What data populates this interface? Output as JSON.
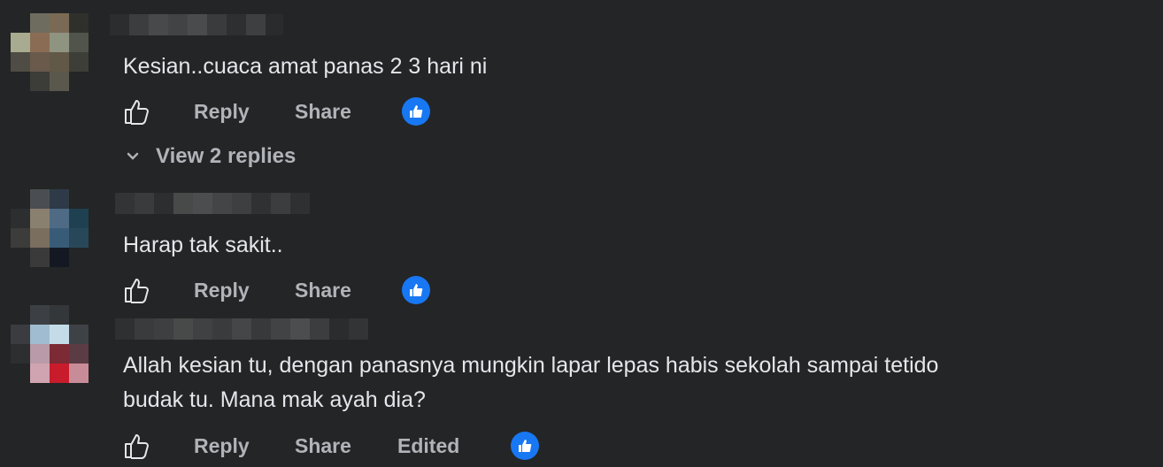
{
  "comments": [
    {
      "text": "Kesian..cuaca amat panas 2 3 hari ni",
      "actions": {
        "reply": "Reply",
        "share": "Share"
      },
      "reaction_icon": "like-reaction-icon",
      "view_replies": "View 2 replies"
    },
    {
      "text": "Harap tak sakit..",
      "actions": {
        "reply": "Reply",
        "share": "Share"
      },
      "reaction_icon": "like-reaction-icon"
    },
    {
      "text_line1": "Allah kesian tu, dengan panasnya mungkin lapar lepas habis sekolah sampai tetido",
      "text_line2": "budak tu. Mana mak ayah dia?",
      "actions": {
        "reply": "Reply",
        "share": "Share",
        "edited": "Edited"
      },
      "reaction_icon": "like-reaction-icon"
    }
  ],
  "colors": {
    "background": "#242526",
    "text": "#e4e6eb",
    "secondary_text": "#b0b3b8",
    "reaction_blue": "#1877f2"
  }
}
